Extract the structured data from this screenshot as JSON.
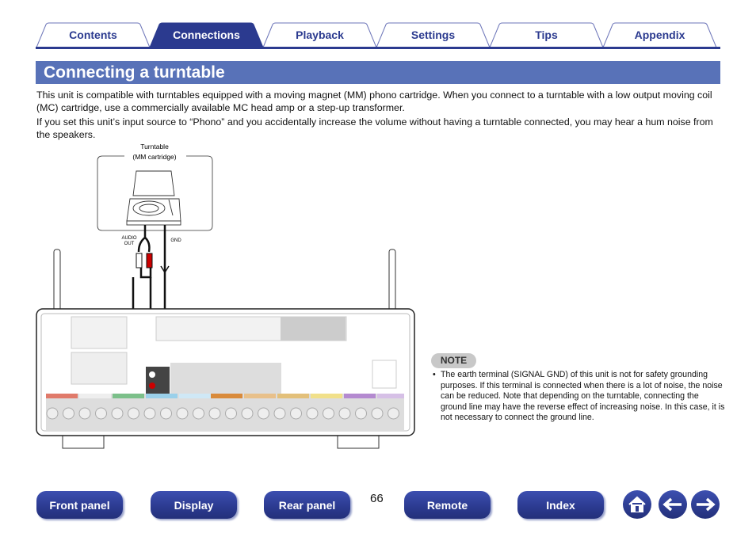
{
  "tabs": [
    {
      "label": "Contents"
    },
    {
      "label": "Connections",
      "active": true
    },
    {
      "label": "Playback"
    },
    {
      "label": "Settings"
    },
    {
      "label": "Tips"
    },
    {
      "label": "Appendix"
    }
  ],
  "title": "Connecting a turntable",
  "paragraphs": [
    "This unit is compatible with turntables equipped with a moving magnet (MM) phono cartridge. When you connect to a turntable with a low output moving coil (MC) cartridge, use a commercially available MC head amp or a step-up transformer.",
    "If you set this unit’s input source to “Phono” and you accidentally increase the volume without having a turntable connected, you may hear a hum noise from the speakers."
  ],
  "diagram": {
    "device_label_1": "Turntable",
    "device_label_2": "(MM cartridge)",
    "audio_out_1": "AUDIO",
    "audio_out_2": "OUT",
    "gnd": "GND"
  },
  "note": {
    "badge": "NOTE",
    "text": "The earth terminal (SIGNAL GND) of this unit is not for safety grounding purposes. If this terminal is connected when there is a lot of noise, the noise can be reduced. Note that depending on the turntable, connecting the ground line may have the reverse effect of increasing noise. In this case, it is not necessary to connect the ground line."
  },
  "footer": {
    "front_panel": "Front panel",
    "display": "Display",
    "rear_panel": "Rear panel",
    "page": "66",
    "remote": "Remote",
    "index": "Index",
    "icons": [
      "home-icon",
      "back-arrow-icon",
      "forward-arrow-icon"
    ]
  },
  "colors": {
    "accent": "#2b3a8f",
    "title_bar": "#5872b8"
  }
}
